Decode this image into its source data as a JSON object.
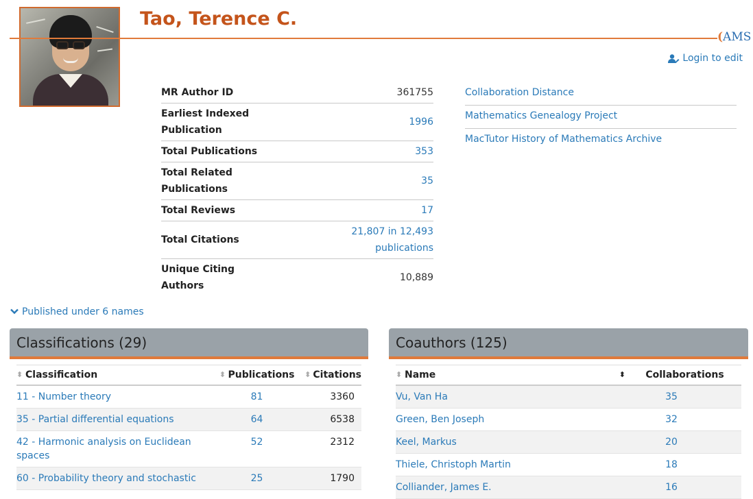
{
  "author": {
    "name": "Tao, Terence C.",
    "logo_text": "AMS",
    "login_label": "Login to edit"
  },
  "stats": [
    {
      "label": "MR Author ID",
      "value": "361755",
      "link": false
    },
    {
      "label": "Earliest Indexed Publication",
      "value": "1996",
      "link": true
    },
    {
      "label": "Total Publications",
      "value": "353",
      "link": true
    },
    {
      "label": "Total Related Publications",
      "value": "35",
      "link": true
    },
    {
      "label": "Total Reviews",
      "value": "17",
      "link": true
    },
    {
      "label": "Total Citations",
      "value": "21,807 in 12,493 publications",
      "link": true
    },
    {
      "label": "Unique Citing Authors",
      "value": "10,889",
      "link": false
    }
  ],
  "external_links": [
    "Collaboration Distance",
    "Mathematics Genealogy Project",
    "MacTutor History of Mathematics Archive"
  ],
  "published_under": "Published under 6 names",
  "classifications": {
    "title": "Classifications (29)",
    "headers": [
      "Classification",
      "Publications",
      "Citations"
    ],
    "rows": [
      {
        "name": "11 - Number theory",
        "publications": "81",
        "citations": "3360"
      },
      {
        "name": "35 - Partial differential equations",
        "publications": "64",
        "citations": "6538"
      },
      {
        "name": "42 - Harmonic analysis on Euclidean spaces",
        "publications": "52",
        "citations": "2312"
      },
      {
        "name": "60 - Probability theory and stochastic",
        "publications": "25",
        "citations": "1790"
      }
    ]
  },
  "coauthors": {
    "title": "Coauthors (125)",
    "headers": [
      "Name",
      "Collaborations"
    ],
    "rows": [
      {
        "name": "Vu, Van Ha",
        "collaborations": "35"
      },
      {
        "name": "Green, Ben Joseph",
        "collaborations": "32"
      },
      {
        "name": "Keel, Markus",
        "collaborations": "20"
      },
      {
        "name": "Thiele, Christoph Martin",
        "collaborations": "18"
      },
      {
        "name": "Colliander, James E.",
        "collaborations": "16"
      }
    ]
  },
  "colors": {
    "accent": "#e07a3a",
    "name": "#c4541b",
    "link": "#2a7ab8",
    "panel_header": "#9aa2a8"
  }
}
